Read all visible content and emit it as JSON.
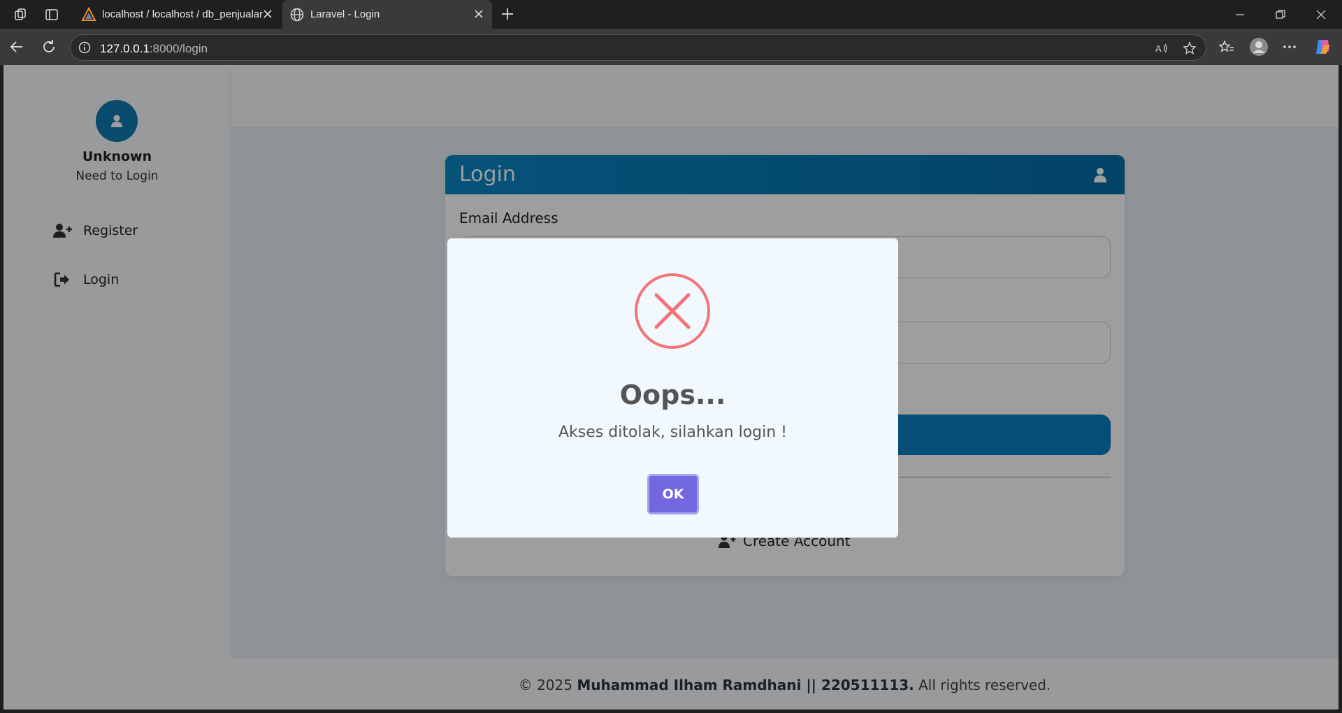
{
  "browser": {
    "tabs": [
      {
        "title": "localhost / localhost / db_penjualan",
        "active": false
      },
      {
        "title": "Laravel - Login",
        "active": true
      }
    ],
    "url_host": "127.0.0.1",
    "url_path": ":8000/login"
  },
  "sidebar": {
    "user_name": "Unknown",
    "user_status": "Need to Login",
    "items": [
      {
        "label": "Register",
        "icon": "user-plus-icon"
      },
      {
        "label": "Login",
        "icon": "sign-in-icon"
      }
    ]
  },
  "login_card": {
    "title": "Login",
    "email_label": "Email Address",
    "create_account": "Create Account"
  },
  "footer": {
    "prefix": "© 2025 ",
    "owner": "Muhammad Ilham Ramdhani || 220511113.",
    "suffix": " All rights reserved."
  },
  "alert": {
    "title": "Oops...",
    "message": "Akses ditolak, silahkan login !",
    "confirm_label": "OK",
    "icon": "error-x-icon",
    "icon_color": "#f27474"
  },
  "colors": {
    "primary": "#0a7fc0",
    "confirm": "#7367e0"
  }
}
